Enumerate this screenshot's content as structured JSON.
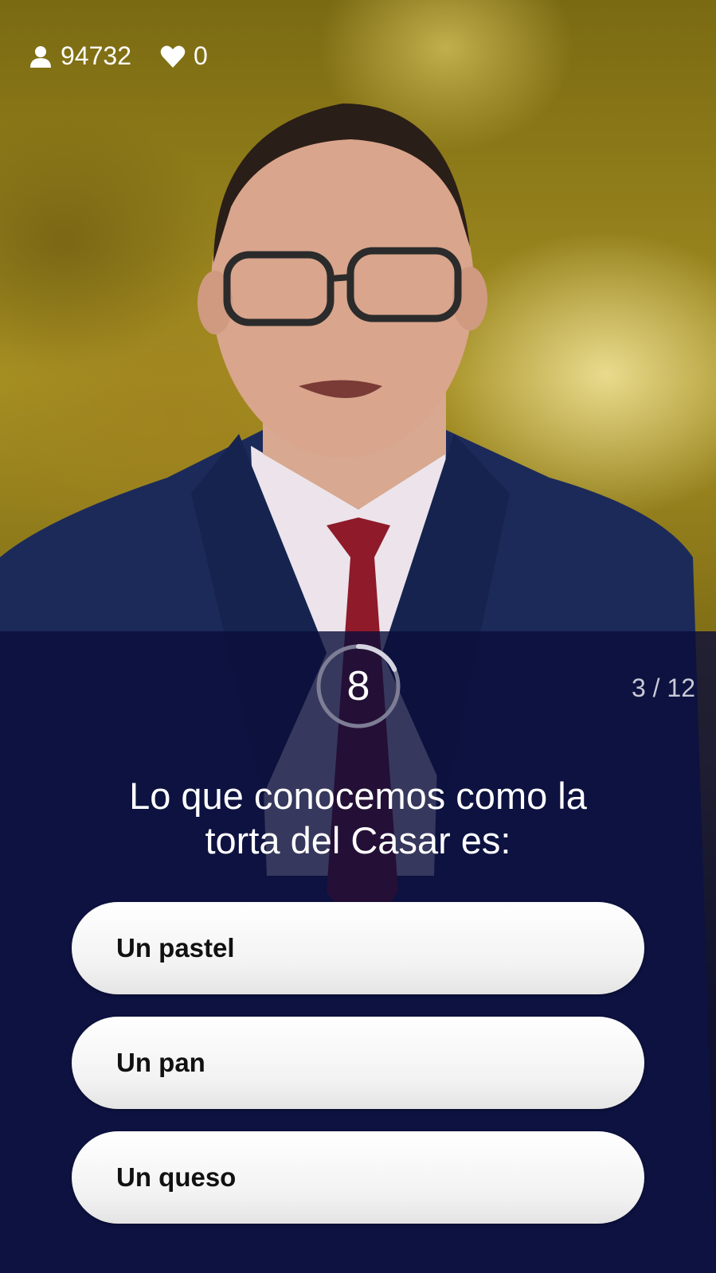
{
  "stats": {
    "viewers_icon": "person-icon",
    "viewers_count": "94732",
    "lives_icon": "heart-icon",
    "lives_count": "0"
  },
  "quiz": {
    "timer_value": "8",
    "timer_progress_fraction": 0.18,
    "progress_text": "3 / 12",
    "question_line1": "Lo que conocemos como la",
    "question_line2": "torta del Casar es:",
    "answers": [
      {
        "label": "Un pastel"
      },
      {
        "label": "Un pan"
      },
      {
        "label": "Un queso"
      }
    ]
  },
  "colors": {
    "panel_bg": "#0a0c3a",
    "answer_bg": "#ffffff",
    "timer_ring": "#9a9ab0"
  }
}
